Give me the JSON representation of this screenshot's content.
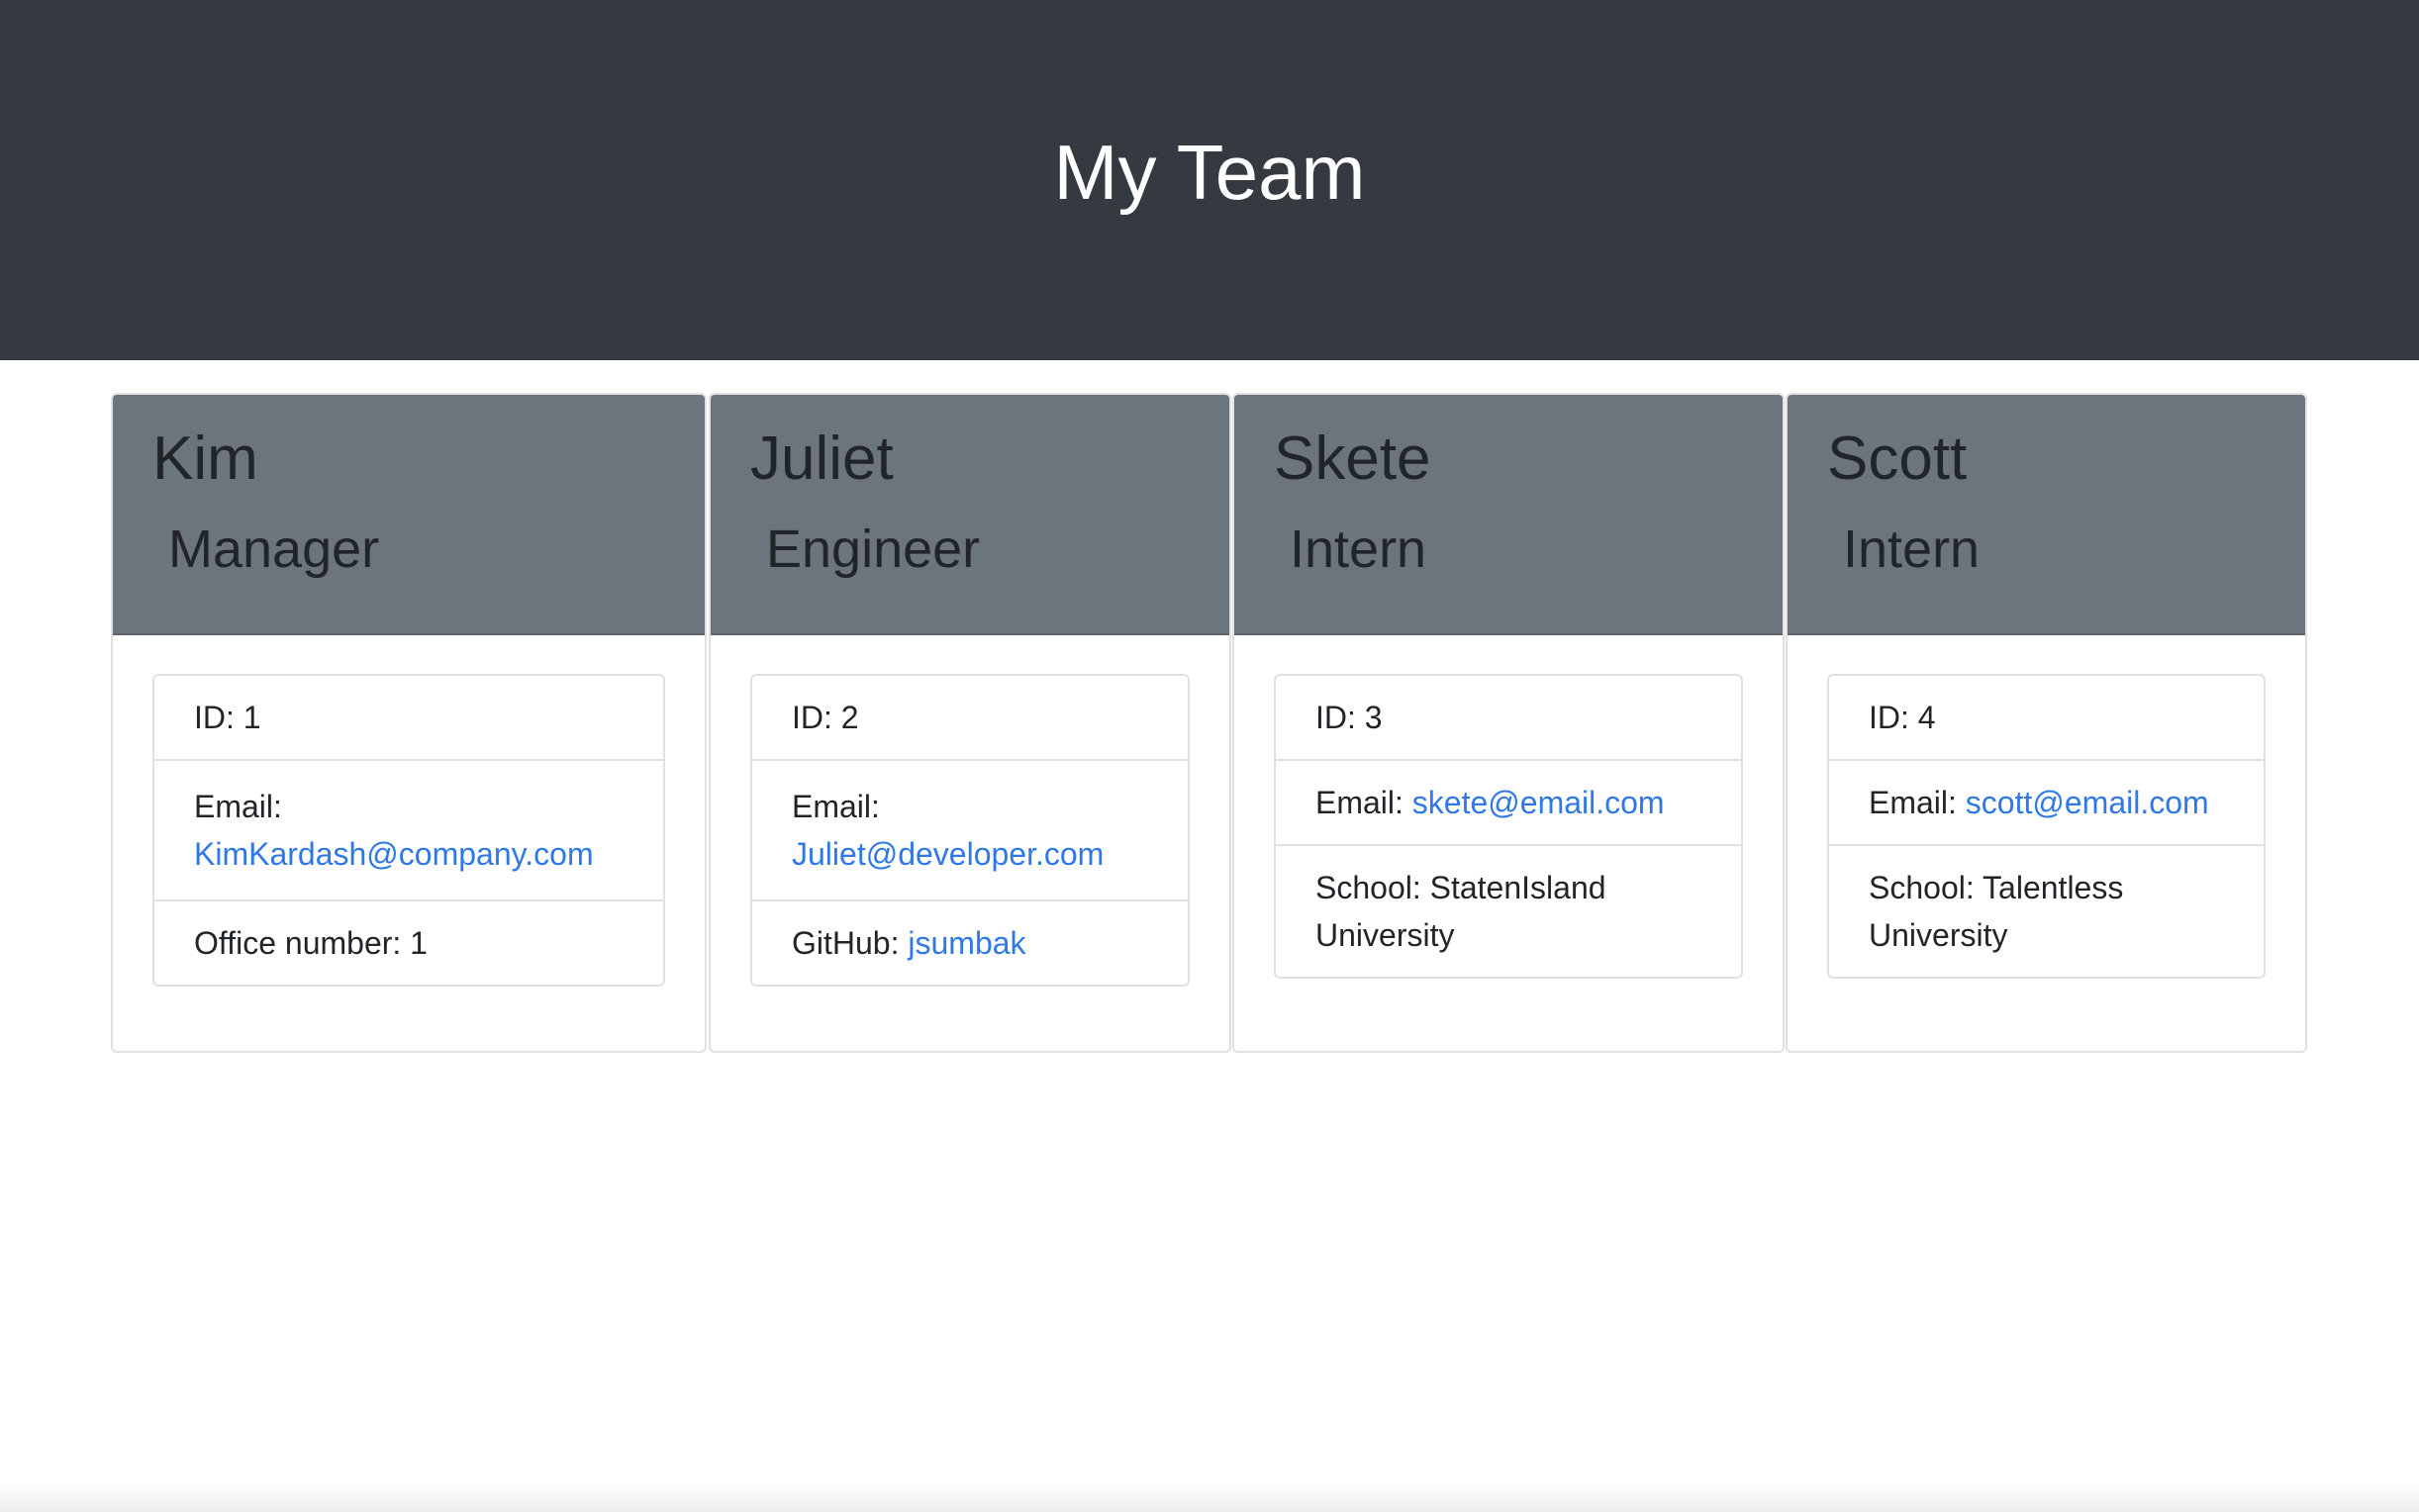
{
  "header": {
    "title": "My Team"
  },
  "team": [
    {
      "name": "Kim",
      "role": "Manager",
      "id_label": "ID: 1",
      "email_label": "Email:",
      "email": "KimKardash@company.com",
      "extra_label": "Office number: 1",
      "extra_link": ""
    },
    {
      "name": "Juliet",
      "role": "Engineer",
      "id_label": "ID: 2",
      "email_label": "Email:",
      "email": "Juliet@developer.com",
      "extra_label": "GitHub:",
      "extra_link": "jsumbak"
    },
    {
      "name": "Skete",
      "role": "Intern",
      "id_label": "ID: 3",
      "email_label": "Email:",
      "email": "skete@email.com",
      "extra_label": "School: StatenIsland University",
      "extra_link": ""
    },
    {
      "name": "Scott",
      "role": "Intern",
      "id_label": "ID: 4",
      "email_label": "Email:",
      "email": "scott@email.com",
      "extra_label": "School: Talentless University",
      "extra_link": ""
    }
  ],
  "colors": {
    "header_bg": "#343a40",
    "card_header_bg": "#6c757d",
    "link": "#2f78e6"
  }
}
